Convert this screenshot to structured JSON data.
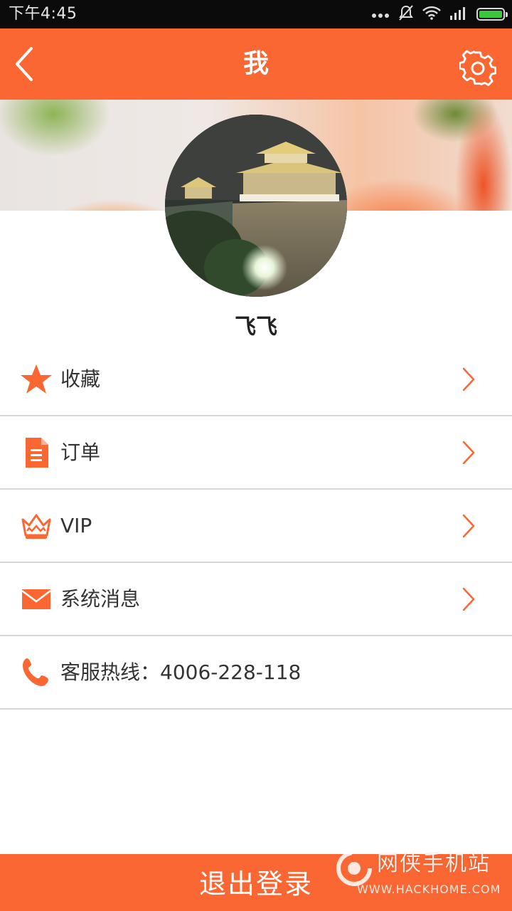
{
  "status_bar": {
    "time": "下午4:45",
    "battery_level": 1.0
  },
  "header": {
    "title": "我",
    "back_icon": "chevron-left-icon",
    "settings_icon": "gear-icon"
  },
  "profile": {
    "username": "飞飞"
  },
  "menu": {
    "items": [
      {
        "label": "收藏",
        "icon": "star-icon"
      },
      {
        "label": "订单",
        "icon": "document-icon"
      },
      {
        "label": "VIP",
        "icon": "crown-icon"
      },
      {
        "label": "系统消息",
        "icon": "envelope-icon"
      },
      {
        "label": "客服热线：4006-228-118",
        "icon": "phone-icon"
      }
    ]
  },
  "footer": {
    "logout_label": "退出登录"
  },
  "watermark": {
    "name": "网侠手机站",
    "url": "WWW.HACKHOME.COM"
  },
  "colors": {
    "accent": "#fb6732",
    "divider": "#d7d7d7",
    "text": "#333333"
  }
}
